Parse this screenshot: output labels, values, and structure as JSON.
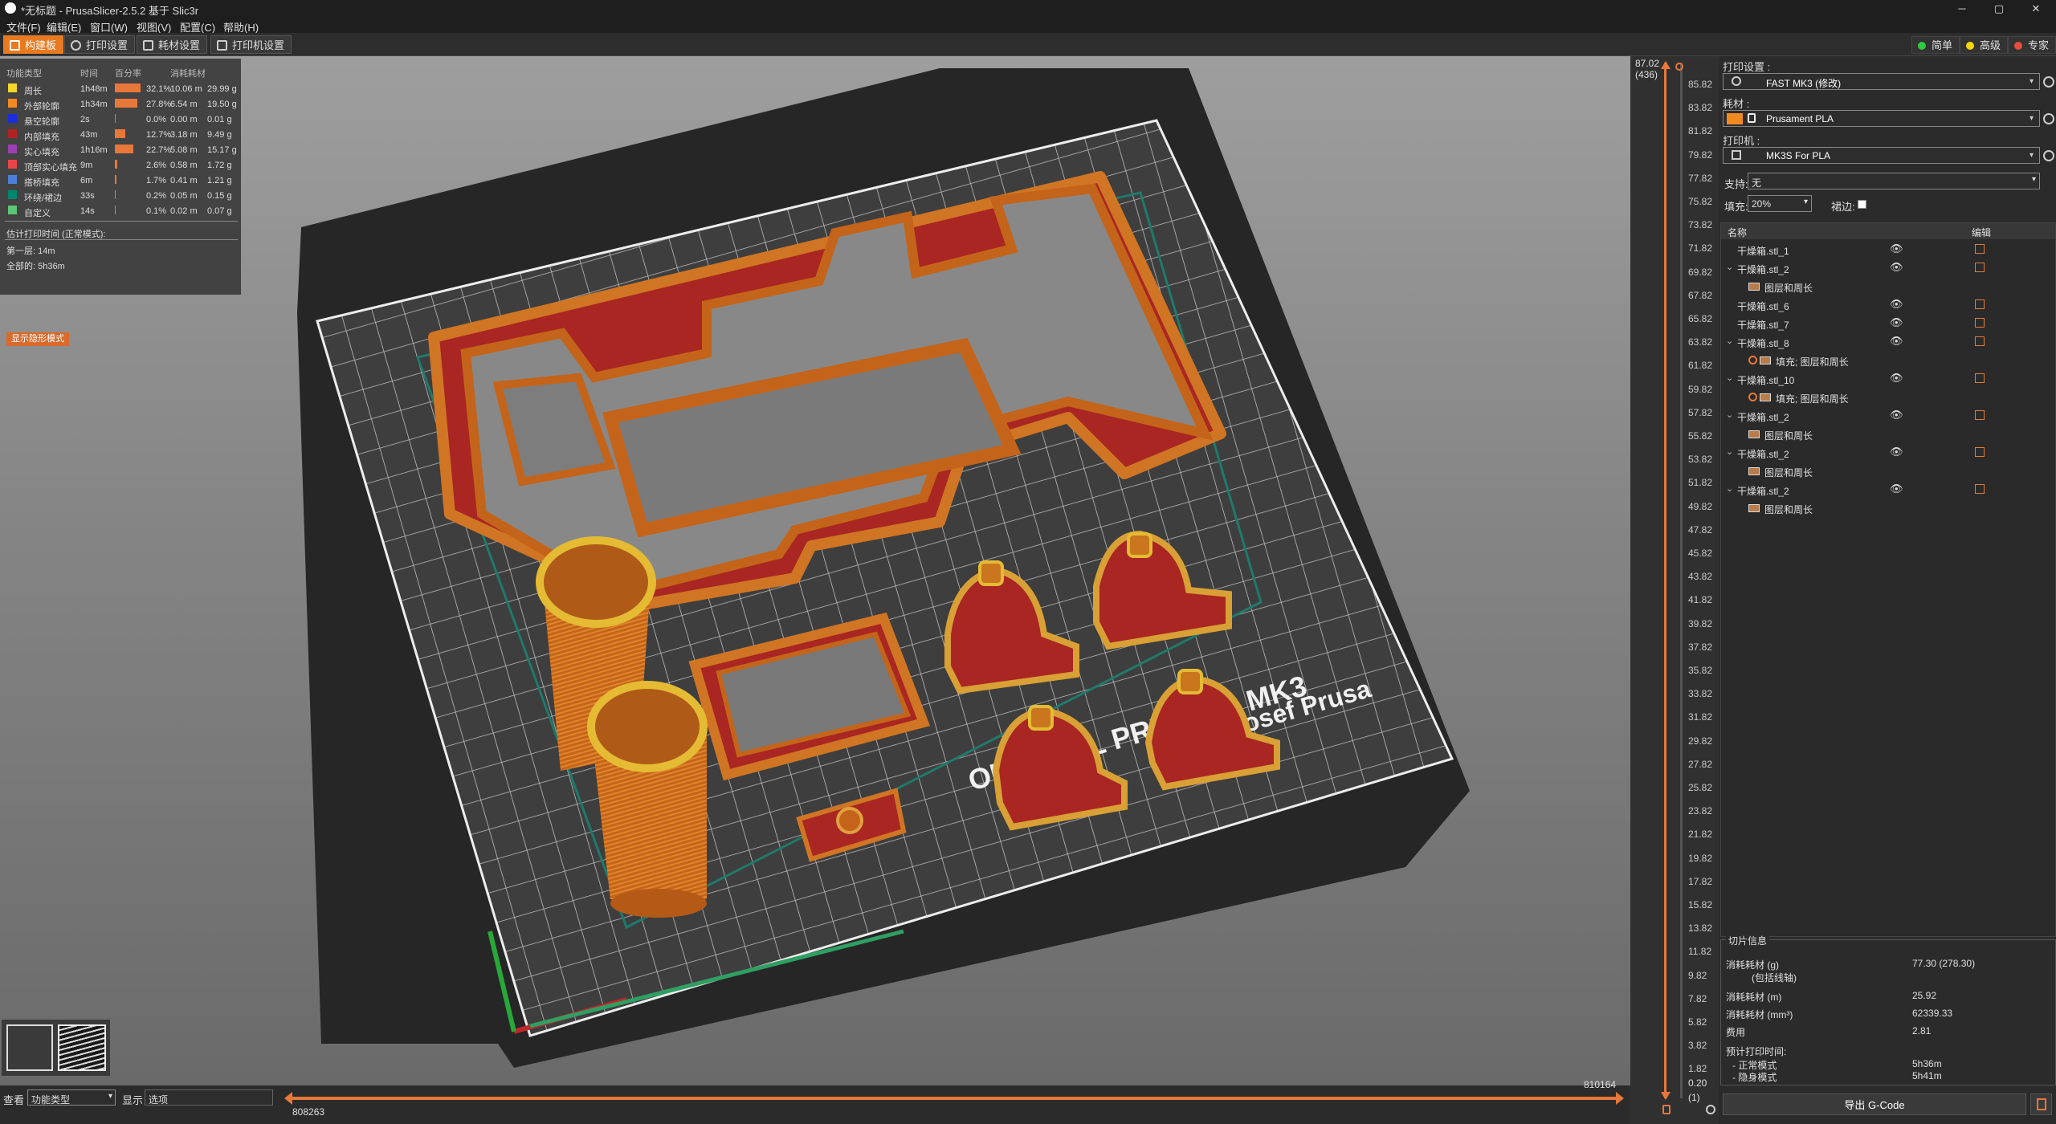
{
  "window": {
    "title": "*无标题 - PrusaSlicer-2.5.2 基于 Slic3r",
    "minimize": "─",
    "maximize": "▢",
    "close": "✕"
  },
  "menu": [
    "文件(F)",
    "编辑(E)",
    "窗口(W)",
    "视图(V)",
    "配置(C)",
    "帮助(H)"
  ],
  "tabs": [
    "构建板",
    "打印设置",
    "耗材设置",
    "打印机设置"
  ],
  "modes": [
    {
      "label": "简单",
      "color": "#2ecc40"
    },
    {
      "label": "高级",
      "color": "#f5d60a"
    },
    {
      "label": "专家",
      "color": "#e74c3c"
    }
  ],
  "legend": {
    "headers": [
      "功能类型",
      "时间",
      "百分率",
      "",
      "消耗耗材"
    ],
    "rows": [
      {
        "name": "周长",
        "color": "#f5d62b",
        "time": "1h48m",
        "pct": "32.1%",
        "len": "10.06 m",
        "weight": "29.99 g",
        "share": 0.321
      },
      {
        "name": "外部轮廓",
        "color": "#f28a22",
        "time": "1h34m",
        "pct": "27.8%",
        "len": "6.54 m",
        "weight": "19.50 g",
        "share": 0.278
      },
      {
        "name": "悬空轮廓",
        "color": "#1a2ddb",
        "time": "2s",
        "pct": "0.0%",
        "len": "0.00 m",
        "weight": "0.01 g",
        "share": 0.0
      },
      {
        "name": "内部填充",
        "color": "#b02323",
        "time": "43m",
        "pct": "12.7%",
        "len": "3.18 m",
        "weight": "9.49 g",
        "share": 0.127
      },
      {
        "name": "实心填充",
        "color": "#9c3fb3",
        "time": "1h16m",
        "pct": "22.7%",
        "len": "5.08 m",
        "weight": "15.17 g",
        "share": 0.227
      },
      {
        "name": "顶部实心填充",
        "color": "#e8454a",
        "time": "9m",
        "pct": "2.6%",
        "len": "0.58 m",
        "weight": "1.72 g",
        "share": 0.026
      },
      {
        "name": "搭桥填充",
        "color": "#4d7fd9",
        "time": "6m",
        "pct": "1.7%",
        "len": "0.41 m",
        "weight": "1.21 g",
        "share": 0.017
      },
      {
        "name": "环绕/裙边",
        "color": "#00876f",
        "time": "33s",
        "pct": "0.2%",
        "len": "0.05 m",
        "weight": "0.15 g",
        "share": 0.002
      },
      {
        "name": "自定义",
        "color": "#5ec476",
        "time": "14s",
        "pct": "0.1%",
        "len": "0.02 m",
        "weight": "0.07 g",
        "share": 0.001
      }
    ],
    "estimate_title": "估计打印时间 (正常模式):",
    "first_layer": "第一层:  14m",
    "total": "全部的:  5h36m",
    "show_button": "显示隐形模式"
  },
  "bed_text": {
    "line1": "ORIGINAL PRUSA i3 MK3",
    "line2": "by Josef Prusa"
  },
  "vslider": {
    "top": "87.02",
    "top_sub": "(436)",
    "bottom": "0.20",
    "bottom_sub": "(1)",
    "ticks": [
      "85.82",
      "83.82",
      "81.82",
      "79.82",
      "77.82",
      "75.82",
      "73.82",
      "71.82",
      "69.82",
      "67.82",
      "65.82",
      "63.82",
      "61.82",
      "59.82",
      "57.82",
      "55.82",
      "53.82",
      "51.82",
      "49.82",
      "47.82",
      "45.82",
      "43.82",
      "41.82",
      "39.82",
      "37.82",
      "35.82",
      "33.82",
      "31.82",
      "29.82",
      "27.82",
      "25.82",
      "23.82",
      "21.82",
      "19.82",
      "17.82",
      "15.82",
      "13.82",
      "11.82",
      "9.82",
      "7.82",
      "5.82",
      "3.82",
      "1.82"
    ]
  },
  "hslider": {
    "left": "808263",
    "right": "810164"
  },
  "bottombar": {
    "view_label": "查看",
    "view_value": "功能类型",
    "show_label": "显示",
    "show_value": "选项"
  },
  "right": {
    "print_label": "打印设置 :",
    "print_value": "FAST MK3 (修改)",
    "filament_label": "耗材 :",
    "filament_value": "Prusament PLA",
    "filament_color": "#f28a22",
    "printer_label": "打印机 :",
    "printer_value": "MK3S For PLA",
    "support_label": "支持:",
    "support_value": "无",
    "infill_label": "填充:",
    "infill_value": "20%",
    "brim_label": "裙边:",
    "col_name": "名称",
    "col_edit": "编辑"
  },
  "objects": [
    {
      "name": "干燥箱.stl_1",
      "eye": true,
      "indent": 0
    },
    {
      "name": "干燥箱.stl_2",
      "eye": true,
      "indent": 0,
      "exp": true
    },
    {
      "name": "图层和周长",
      "eye": false,
      "indent": 1
    },
    {
      "name": "干燥箱.stl_6",
      "eye": true,
      "indent": 0
    },
    {
      "name": "干燥箱.stl_7",
      "eye": true,
      "indent": 0
    },
    {
      "name": "干燥箱.stl_8",
      "eye": true,
      "indent": 0,
      "exp": true
    },
    {
      "name": "填充; 图层和周长",
      "eye": false,
      "indent": 1,
      "gear": true
    },
    {
      "name": "干燥箱.stl_10",
      "eye": true,
      "indent": 0,
      "exp": true
    },
    {
      "name": "填充; 图层和周长",
      "eye": false,
      "indent": 1,
      "gear": true
    },
    {
      "name": "干燥箱.stl_2",
      "eye": true,
      "indent": 0,
      "exp": true
    },
    {
      "name": "图层和周长",
      "eye": false,
      "indent": 1
    },
    {
      "name": "干燥箱.stl_2",
      "eye": true,
      "indent": 0,
      "exp": true
    },
    {
      "name": "图层和周长",
      "eye": false,
      "indent": 1
    },
    {
      "name": "干燥箱.stl_2",
      "eye": true,
      "indent": 0,
      "exp": true
    },
    {
      "name": "图层和周长",
      "eye": false,
      "indent": 1
    }
  ],
  "slice_info": {
    "title": "切片信息",
    "rows": [
      {
        "k": "消耗耗材 (g)",
        "k2": "(包括线轴)",
        "v": "77.30 (278.30)"
      },
      {
        "k": "消耗耗材 (m)",
        "v": "25.92"
      },
      {
        "k": "消耗耗材 (mm³)",
        "v": "62339.33"
      },
      {
        "k": "费用",
        "v": "2.81"
      }
    ],
    "est_title": "预计打印时间:",
    "normal_label": "- 正常模式",
    "normal_value": "5h36m",
    "stealth_label": "- 隐身模式",
    "stealth_value": "5h41m"
  },
  "export_button": "导出 G-Code"
}
